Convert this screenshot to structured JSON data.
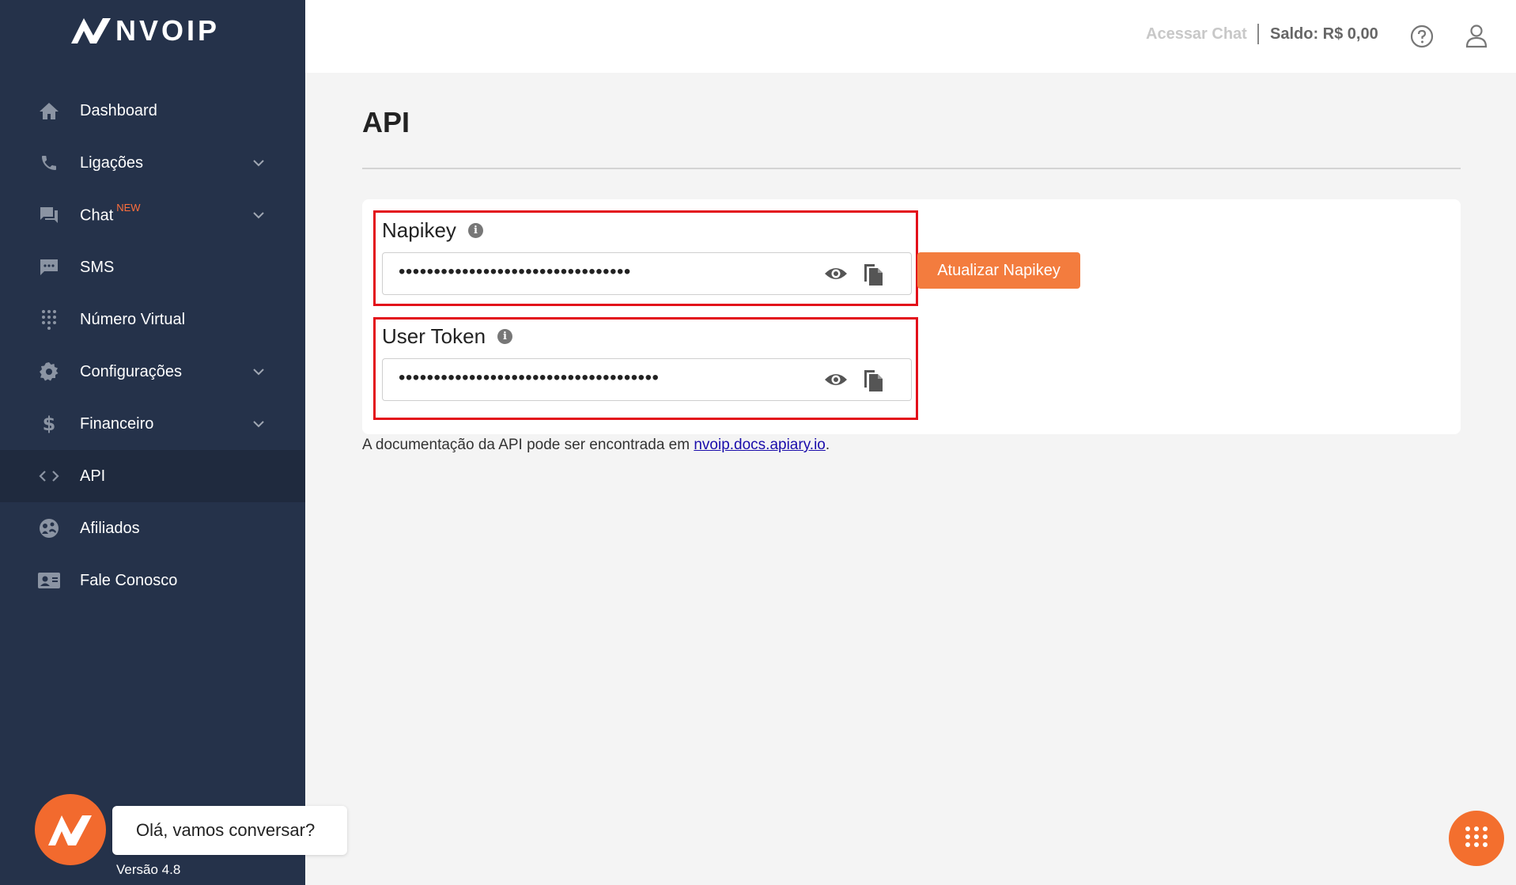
{
  "brand": {
    "name": "NVOIP"
  },
  "sidebar": {
    "items": [
      {
        "label": "Dashboard",
        "icon": "home-icon"
      },
      {
        "label": "Ligações",
        "icon": "phone-icon",
        "has_submenu": true
      },
      {
        "label": "Chat",
        "badge": "NEW",
        "icon": "chat-icon",
        "has_submenu": true
      },
      {
        "label": "SMS",
        "icon": "sms-icon"
      },
      {
        "label": "Número Virtual",
        "icon": "dialpad-icon"
      },
      {
        "label": "Configurações",
        "icon": "gear-icon",
        "has_submenu": true
      },
      {
        "label": "Financeiro",
        "icon": "dollar-icon",
        "has_submenu": true
      },
      {
        "label": "API",
        "icon": "code-icon",
        "active": true
      },
      {
        "label": "Afiliados",
        "icon": "affiliates-icon"
      },
      {
        "label": "Fale Conosco",
        "icon": "contact-card-icon"
      }
    ],
    "version": "Versão 4.8"
  },
  "chat_widget": {
    "greeting": "Olá, vamos conversar?"
  },
  "topbar": {
    "access_chat": "Acessar Chat",
    "balance": "Saldo: R$ 0,00"
  },
  "main": {
    "title": "API",
    "napikey": {
      "label": "Napikey",
      "value": "•••••••••••••••••••••••••••••••••"
    },
    "user_token": {
      "label": "User Token",
      "value": "•••••••••••••••••••••••••••••••••••••"
    },
    "update_button": "Atualizar Napikey",
    "docs_text": "A documentação da API pode ser encontrada em ",
    "docs_link": "nvoip.docs.apiary.io",
    "docs_suffix": "."
  },
  "colors": {
    "sidebar_bg": "#25324a",
    "accent": "#f37c3e",
    "highlight_border": "#e3101a"
  }
}
